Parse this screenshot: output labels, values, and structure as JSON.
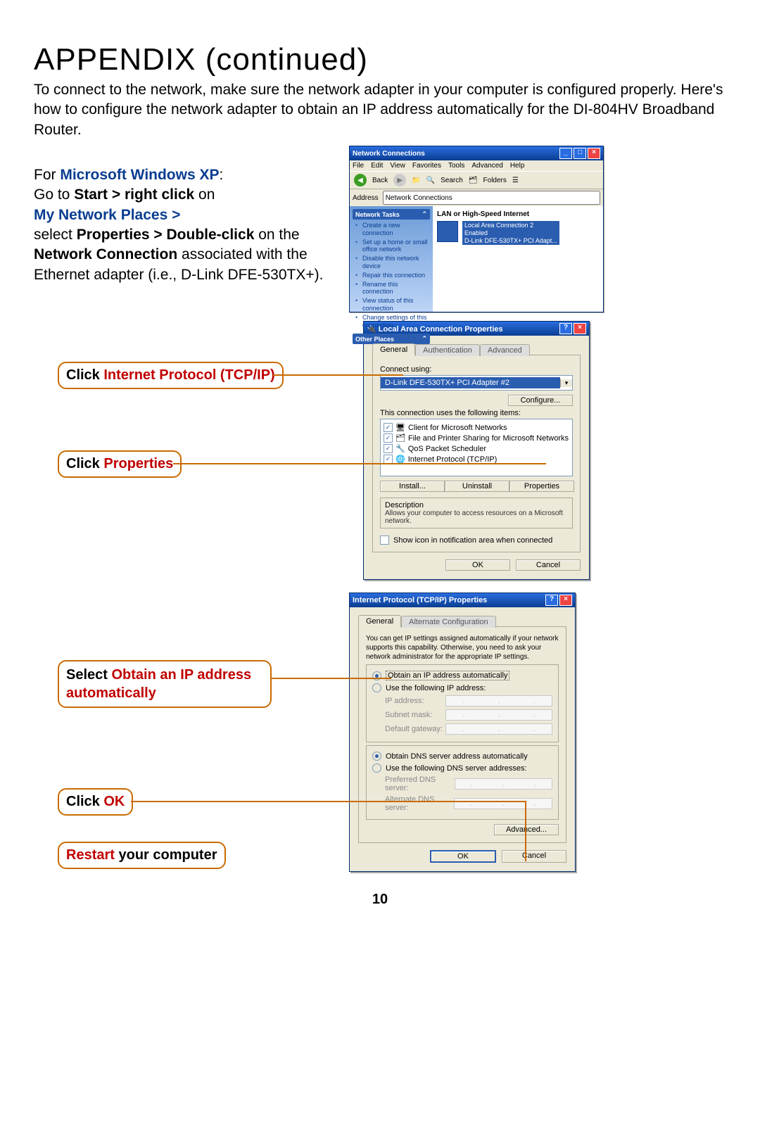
{
  "heading": "APPENDIX (continued)",
  "intro": "To connect to the network, make sure the network adapter in your computer is configured properly. Here's how to configure the network adapter to obtain an IP address automatically for the DI-804HV Broadband Router.",
  "pagenum": "10",
  "instructions": {
    "for_prefix": "For ",
    "for_os": "Microsoft Windows XP",
    "colon": ":",
    "l1a": "Go to ",
    "l1b": "Start > right click",
    "l1c": " on ",
    "l2a": "My Network Places > ",
    "l3a": "select ",
    "l3b": "Properties > Double-click",
    "l3c": " on the ",
    "l3d": "Network Connection",
    "l3e": " associated with the Ethernet adapter (i.e., D-Link DFE-530TX+)."
  },
  "callouts": {
    "c1a": "Click ",
    "c1b": "Internet Protocol (TCP/IP)",
    "c2a": "Click ",
    "c2b": "Properties",
    "c3a": "Select ",
    "c3b": "Obtain an IP address automatically",
    "c4a": "Click ",
    "c4b": "OK",
    "c5a": "Restart",
    "c5b": " your computer"
  },
  "win1": {
    "title": "Network Connections",
    "menu": {
      "file": "File",
      "edit": "Edit",
      "view": "View",
      "fav": "Favorites",
      "tools": "Tools",
      "adv": "Advanced",
      "help": "Help"
    },
    "toolbar": {
      "back": "Back",
      "search": "Search",
      "folders": "Folders"
    },
    "address_label": "Address",
    "address_value": "Network Connections",
    "tasks_hdr": "Network Tasks",
    "tasks": [
      "Create a new connection",
      "Set up a home or small office network",
      "Disable this network device",
      "Repair this connection",
      "Rename this connection",
      "View status of this connection",
      "Change settings of this connection"
    ],
    "other_hdr": "Other Places",
    "category": "LAN or High-Speed Internet",
    "item_name": "Local Area Connection 2",
    "item_status": "Enabled",
    "item_adapter": "D-Link DFE-530TX+ PCI Adapt..."
  },
  "dlg1": {
    "title": "Local Area Connection Properties",
    "tabs": {
      "general": "General",
      "auth": "Authentication",
      "adv": "Advanced"
    },
    "connect_using": "Connect using:",
    "adapter": "D-Link DFE-530TX+ PCI Adapter #2",
    "configure": "Configure...",
    "uses": "This connection uses the following items:",
    "items": [
      "Client for Microsoft Networks",
      "File and Printer Sharing for Microsoft Networks",
      "QoS Packet Scheduler",
      "Internet Protocol (TCP/IP)"
    ],
    "install": "Install...",
    "uninstall": "Uninstall",
    "properties": "Properties",
    "desc_label": "Description",
    "desc_text": "Allows your computer to access resources on a Microsoft network.",
    "show_icon": "Show icon in notification area when connected",
    "ok": "OK",
    "cancel": "Cancel"
  },
  "dlg2": {
    "title": "Internet Protocol (TCP/IP) Properties",
    "tabs": {
      "general": "General",
      "alt": "Alternate Configuration"
    },
    "blurb": "You can get IP settings assigned automatically if your network supports this capability. Otherwise, you need to ask your network administrator for the appropriate IP settings.",
    "r1": "Obtain an IP address automatically",
    "r2": "Use the following IP address:",
    "ip": "IP address:",
    "subnet": "Subnet mask:",
    "gateway": "Default gateway:",
    "r3": "Obtain DNS server address automatically",
    "r4": "Use the following DNS server addresses:",
    "pdns": "Preferred DNS server:",
    "adns": "Alternate DNS server:",
    "advanced": "Advanced...",
    "ok": "OK",
    "cancel": "Cancel"
  }
}
